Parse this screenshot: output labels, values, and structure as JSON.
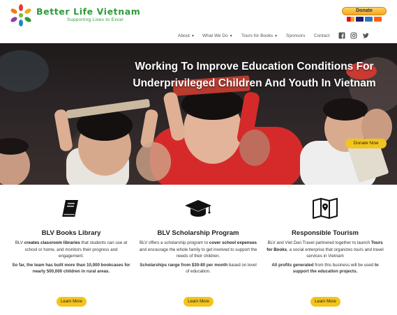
{
  "brand": {
    "name": "Better Life Vietnam",
    "tagline": "Supporting Lives to Excel",
    "colors": {
      "green": "#2e9a3a",
      "accent_yellow": "#f3c41c"
    }
  },
  "donate": {
    "label": "Donate",
    "cards": [
      "mastercard",
      "visa",
      "amex",
      "discover"
    ]
  },
  "nav": {
    "items": [
      {
        "label": "About",
        "dropdown": true
      },
      {
        "label": "What We Do",
        "dropdown": true
      },
      {
        "label": "Tours for Books",
        "dropdown": true
      },
      {
        "label": "Sponsors",
        "dropdown": false
      },
      {
        "label": "Contact",
        "dropdown": false
      }
    ],
    "social_icons": [
      "facebook-icon",
      "instagram-icon",
      "twitter-icon"
    ]
  },
  "hero": {
    "title_line1": "Working To Improve Education Conditions For",
    "title_line2": "Underprivileged Children And Youth In Vietnam",
    "button_label": "Donate Now"
  },
  "columns": [
    {
      "icon": "book-icon",
      "title": "BLV Books Library",
      "p1_a": "BLV ",
      "p1_b": "creates classroom libraries",
      "p1_c": " that students can use at school or home, and monitors their progress and engagement.",
      "p2": "So far, the team has built more than 10,000 bookcases for nearly 500,000 children in rural areas.",
      "button": "Learn More"
    },
    {
      "icon": "graduation-cap-icon",
      "title": "BLV Scholarship Program",
      "p1_a": "BLV offers a scholarship program to ",
      "p1_b": "cover school expenses",
      "p1_c": " and encourage the whole family to get involved to support the needs of their children.",
      "p2_a": "Scholarships range from $30-80 per month",
      "p2_b": " based on level of education.",
      "button": "Learn More"
    },
    {
      "icon": "map-icon",
      "title": "Responsible Tourism",
      "p1_a": "BLV and Viet Dan Travel partnered together to launch ",
      "p1_b": "Tours for Books",
      "p1_c": ", a social enterprise that organizes tours and travel services in Vietnam",
      "p2_a": "All profits generated",
      "p2_b": " from this business will be used ",
      "p2_c": "to support the education projects.",
      "button": "Learn More"
    }
  ]
}
